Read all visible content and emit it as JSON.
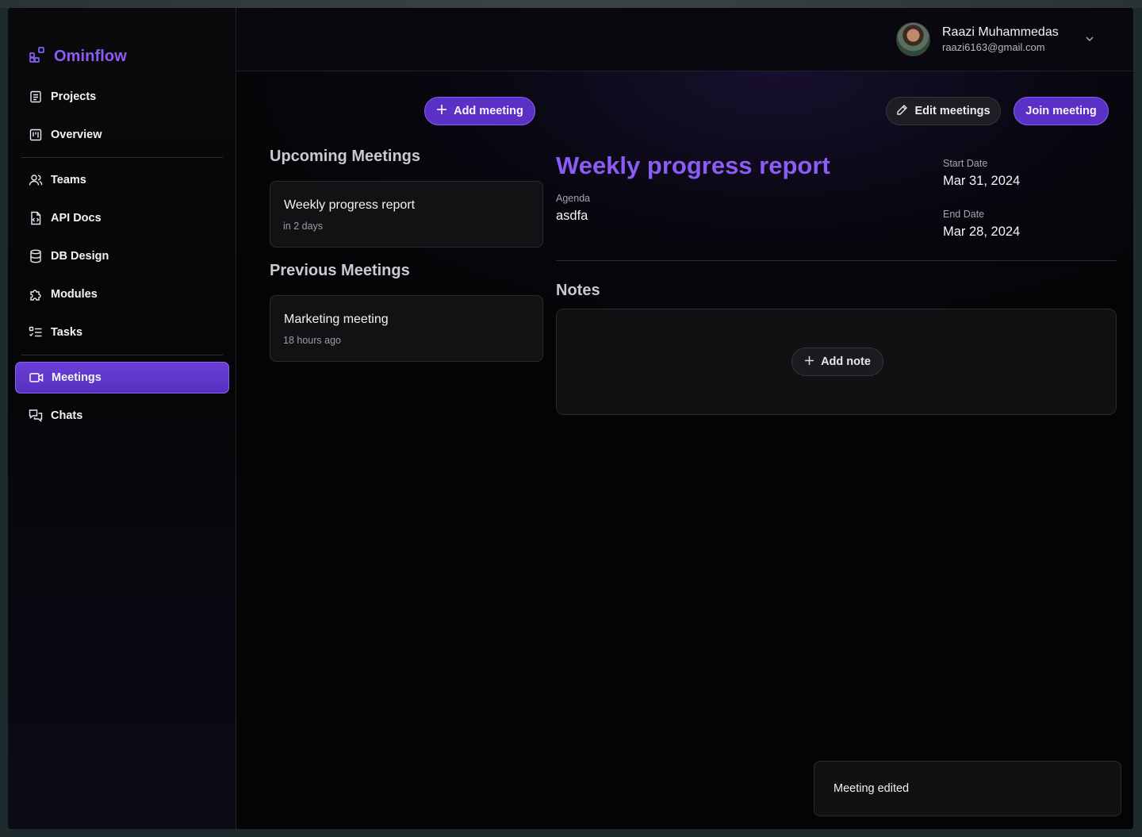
{
  "app": {
    "name": "Ominflow",
    "accent_color": "#8b5cf6"
  },
  "sidebar": {
    "items": [
      {
        "label": "Projects",
        "icon": "document-list-icon"
      },
      {
        "label": "Overview",
        "icon": "kanban-board-icon"
      },
      {
        "label": "Teams",
        "icon": "users-icon"
      },
      {
        "label": "API Docs",
        "icon": "code-file-icon"
      },
      {
        "label": "DB Design",
        "icon": "database-icon"
      },
      {
        "label": "Modules",
        "icon": "puzzle-icon"
      },
      {
        "label": "Tasks",
        "icon": "checklist-icon"
      },
      {
        "label": "Meetings",
        "icon": "video-camera-icon",
        "active": true
      },
      {
        "label": "Chats",
        "icon": "chat-bubbles-icon"
      }
    ]
  },
  "user": {
    "name": "Raazi Muhammedas",
    "email": "raazi6163@gmail.com"
  },
  "toolbar": {
    "add_meeting": "Add meeting",
    "edit_meetings": "Edit meetings",
    "join_meeting": "Join meeting"
  },
  "upcoming": {
    "title": "Upcoming Meetings",
    "items": [
      {
        "title": "Weekly progress report",
        "when": "in 2 days"
      }
    ]
  },
  "previous": {
    "title": "Previous Meetings",
    "items": [
      {
        "title": "Marketing meeting",
        "when": "18 hours ago"
      }
    ]
  },
  "detail": {
    "title": "Weekly progress report",
    "agenda_label": "Agenda",
    "agenda": "asdfa",
    "start_label": "Start Date",
    "start_date": "Mar 31, 2024",
    "end_label": "End Date",
    "end_date": "Mar 28, 2024"
  },
  "notes": {
    "title": "Notes",
    "add_label": "Add note"
  },
  "toast": {
    "message": "Meeting edited"
  }
}
